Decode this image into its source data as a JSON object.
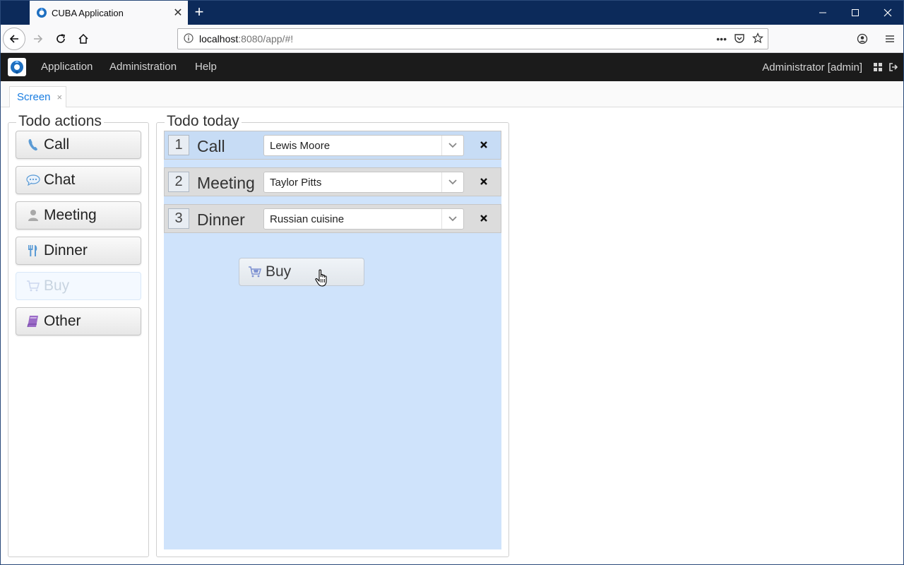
{
  "browser": {
    "tab_title": "CUBA Application",
    "tab_close": "✕",
    "new_tab": "+",
    "url_host": "localhost",
    "url_rest": ":8080/app/#!",
    "window_controls": {
      "minimize": "─",
      "maximize": "☐",
      "close": "✕"
    }
  },
  "app": {
    "menu": [
      "Application",
      "Administration",
      "Help"
    ],
    "user": "Administrator [admin]"
  },
  "screen_tab": {
    "label": "Screen",
    "close": "×"
  },
  "actions_panel": {
    "legend": "Todo actions",
    "buttons": [
      {
        "label": "Call",
        "icon": "phone-icon"
      },
      {
        "label": "Chat",
        "icon": "chat-icon"
      },
      {
        "label": "Meeting",
        "icon": "user-icon"
      },
      {
        "label": "Dinner",
        "icon": "cutlery-icon"
      },
      {
        "label": "Buy",
        "icon": "cart-icon",
        "state": "dragging-placeholder"
      },
      {
        "label": "Other",
        "icon": "book-icon"
      }
    ]
  },
  "today_panel": {
    "legend": "Todo today",
    "rows": [
      {
        "num": "1",
        "label": "Call",
        "value": "Lewis Moore"
      },
      {
        "num": "2",
        "label": "Meeting",
        "value": "Taylor Pitts"
      },
      {
        "num": "3",
        "label": "Dinner",
        "value": "Russian cuisine"
      }
    ],
    "dragging": {
      "label": "Buy",
      "icon": "cart-icon"
    }
  },
  "colors": {
    "browser_frame": "#0c2a5a",
    "app_header": "#1b1b1b",
    "link_blue": "#197de1",
    "dropzone": "#cfe3fb",
    "row_highlight": "#c7dcf5"
  }
}
